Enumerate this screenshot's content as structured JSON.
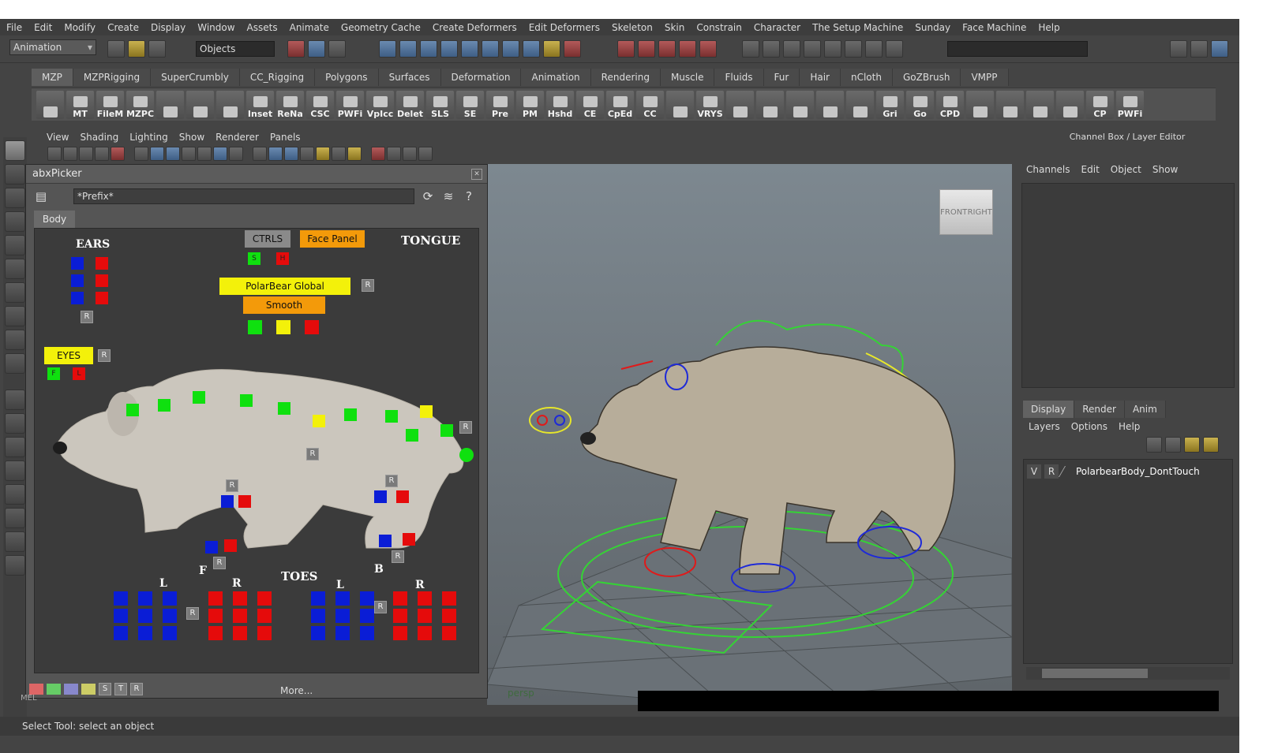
{
  "menubar": [
    "File",
    "Edit",
    "Modify",
    "Create",
    "Display",
    "Window",
    "Assets",
    "Animate",
    "Geometry Cache",
    "Create Deformers",
    "Edit Deformers",
    "Skeleton",
    "Skin",
    "Constrain",
    "Character",
    "The Setup Machine",
    "Sunday",
    "Face Machine",
    "Help"
  ],
  "statusline": {
    "mode": "Animation",
    "selection_mask": "Objects"
  },
  "shelf_tabs": [
    "MZP",
    "MZPRigging",
    "SuperCrumbly",
    "CC_Rigging",
    "Polygons",
    "Surfaces",
    "Deformation",
    "Animation",
    "Rendering",
    "Muscle",
    "Fluids",
    "Fur",
    "Hair",
    "nCloth",
    "GoZBrush",
    "VMPP"
  ],
  "shelf_active": "MZP",
  "shelf_buttons": [
    "",
    "MT",
    "FileM",
    "MZPC",
    "",
    "",
    "",
    "Inset",
    "ReNa",
    "CSC",
    "PWFi",
    "VpIcc",
    "Delet",
    "SLS",
    "SE",
    "Pre",
    "PM",
    "Hshd",
    "CE",
    "CpEd",
    "CC",
    "",
    "VRYS",
    "",
    "",
    "",
    "",
    "",
    "Gri",
    "Go",
    "CPD",
    "",
    "",
    "",
    "",
    "CP",
    "PWFi"
  ],
  "panel_menu": [
    "View",
    "Shading",
    "Lighting",
    "Show",
    "Renderer",
    "Panels"
  ],
  "picker": {
    "title": "abxPicker",
    "prefix": "*Prefix*",
    "tab": "Body",
    "labels": {
      "ears": "EARS",
      "tongue": "TONGUE",
      "toes": "TOES",
      "front": "F",
      "back": "B",
      "left1": "L",
      "right1": "R",
      "left2": "L",
      "right2": "R"
    },
    "buttons": {
      "ctrls": "CTRLS",
      "face_panel": "Face Panel",
      "global": "PolarBear Global",
      "smooth": "Smooth",
      "eyes": "EYES"
    },
    "small": {
      "s": "S",
      "h": "H",
      "f": "F",
      "l": "L",
      "r": "R"
    },
    "bottom": {
      "s": "S",
      "t": "T",
      "r": "R",
      "more": "More..."
    }
  },
  "viewport": {
    "cube_front": "FRONT",
    "cube_right": "RIGHT",
    "camera": "persp"
  },
  "channel_box": {
    "title": "Channel Box / Layer Editor",
    "menu": [
      "Channels",
      "Edit",
      "Object",
      "Show"
    ]
  },
  "layer_editor": {
    "tabs": [
      "Display",
      "Render",
      "Anim"
    ],
    "active_tab": "Display",
    "menu": [
      "Layers",
      "Options",
      "Help"
    ],
    "layer": {
      "v": "V",
      "r": "R",
      "name": "PolarbearBody_DontTouch"
    }
  },
  "command_line": {
    "label": "MEL"
  },
  "help_line": "Select Tool: select an object",
  "colors": {
    "blue": "#0a1dd6",
    "red": "#e50b0b",
    "green": "#0fe00f",
    "yellow": "#f3f10a",
    "orange": "#f39a0a"
  }
}
